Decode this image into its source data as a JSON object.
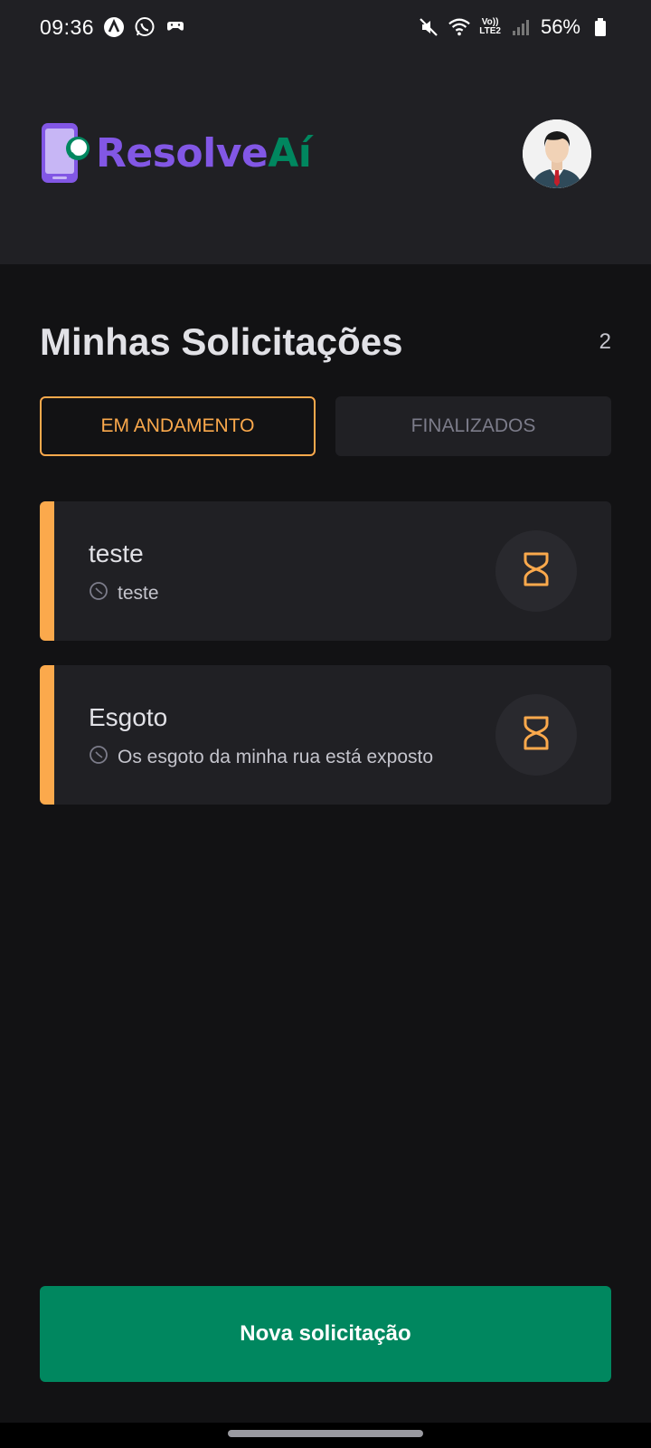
{
  "status_bar": {
    "time": "09:36",
    "battery": "56%",
    "network_top": "Vo))",
    "network_bottom": "LTE2",
    "icons": [
      "a-icon",
      "whatsapp-icon",
      "game-controller-icon",
      "mute-icon",
      "wifi-icon",
      "signal-icon",
      "battery-icon"
    ]
  },
  "header": {
    "logo_part1": "Resolve",
    "logo_part2": "Aí",
    "colors": {
      "purple": "#8257e5",
      "green": "#00875f"
    }
  },
  "main": {
    "title": "Minhas Solicitações",
    "count": "2",
    "tabs": [
      {
        "label": "EM ANDAMENTO",
        "active": true
      },
      {
        "label": "FINALIZADOS",
        "active": false
      }
    ],
    "requests": [
      {
        "title": "teste",
        "description": "teste",
        "status_icon": "hourglass-icon"
      },
      {
        "title": "Esgoto",
        "description": "Os esgoto da minha rua está exposto",
        "status_icon": "hourglass-icon"
      }
    ]
  },
  "actions": {
    "new_request_label": "Nova solicitação"
  },
  "colors": {
    "accent_orange": "#fba94c",
    "primary_green": "#00875f",
    "background": "#121214",
    "surface": "#202024"
  }
}
